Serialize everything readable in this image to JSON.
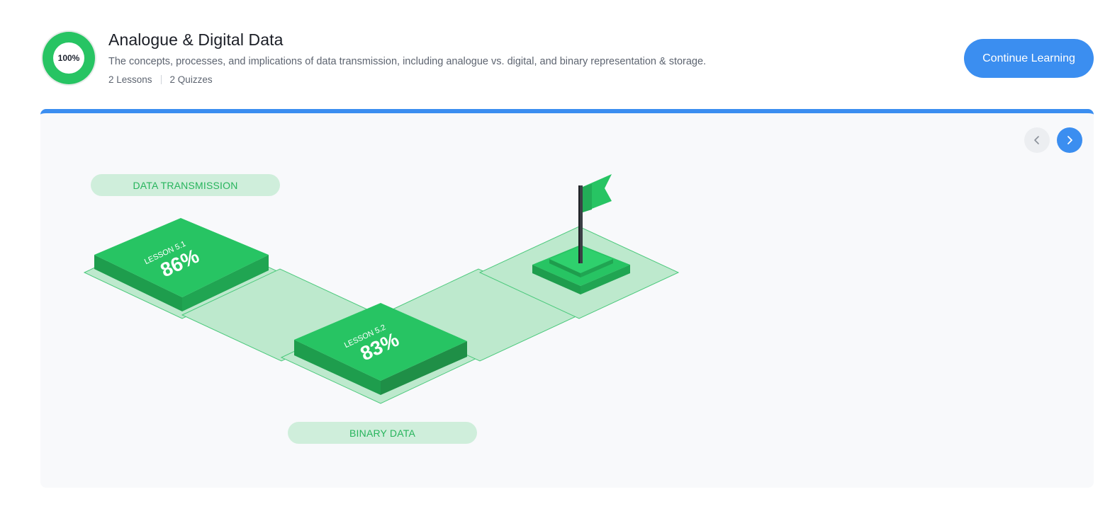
{
  "course": {
    "progress_label": "100%",
    "title": "Analogue & Digital Data",
    "description": "The concepts, processes, and implications of data transmission, including analogue vs. digital, and binary representation & storage.",
    "lessons_count": "2 Lessons",
    "quizzes_count": "2 Quizzes",
    "continue_label": "Continue Learning"
  },
  "map": {
    "sections": [
      "DATA TRANSMISSION",
      "BINARY DATA"
    ],
    "lessons": [
      {
        "label": "LESSON 5.1",
        "score": "86%"
      },
      {
        "label": "LESSON 5.2",
        "score": "83%"
      }
    ],
    "nav": {
      "prev_icon": "chevron-left-icon",
      "next_icon": "chevron-right-icon"
    }
  },
  "colors": {
    "accent": "#3b8ef0",
    "green": "#27c463",
    "tile": "#bde9cd",
    "pill_bg": "#cfeedb",
    "pill_text": "#27b45c"
  }
}
